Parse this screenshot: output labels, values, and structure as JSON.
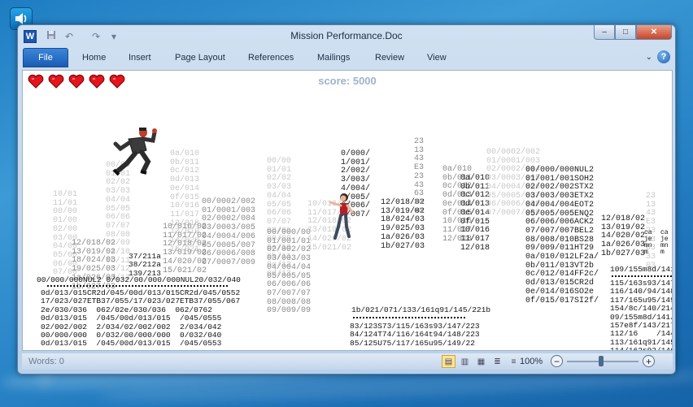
{
  "desktop": {
    "sound_icon": "speaker-icon"
  },
  "window": {
    "title": "Mission Performance.Doc",
    "app_icon_letter": "W",
    "quick_access_icons": [
      "save-icon",
      "undo-icon",
      "redo-icon",
      "customize-icon"
    ],
    "buttons": {
      "minimize": "–",
      "maximize": "□",
      "close": "✕"
    }
  },
  "ribbon": {
    "file_label": "File",
    "tabs": [
      "Home",
      "Insert",
      "Page Layout",
      "References",
      "Mailings",
      "Review",
      "View"
    ],
    "help_label": "?"
  },
  "game": {
    "lives": 5,
    "score_text": "score: 5000",
    "heart_color": "#e8141b"
  },
  "matrix": {
    "c1": "10/01\n11/01\n00/00\n01/00\n02/00\n03/00\n04/00\n05/00\n06/00\n07/00",
    "c2": "00/000/00\n01/001/01\n02/002/02\n03/003/03\n04/004/04\n05/005/05\n06/006/06\n07/007/07\n08/008/08\n09/009/09",
    "c3": "0a/010\n0b/011\n0c/012\n0d/013\n0e/014\n0f/015\n10/016\n11/017\n12/018\n13/019\n14/020\n15/021",
    "c4": "00/00\n01/01\n02/02\n03/03\n04/04\n05/05\n06/06\n07/07\n08/08\n09/09\n0a/10\n0b/11\n0c/12\n0d/13",
    "c5": "00/0002/002\n01/0001/003\n02/0002/004\n03/0003/005\n04/0004/006\n05/0005/007\n06/0006/008\n07/0007/009",
    "c6": "23\n13\n43\nE3\n23\n43\n63\n33\n03",
    "c7": "00/000/000NUL2\n01/001/001SOH2\n02/002/002STX2\n03/003/003ETX2\n04/004/004EOT2\n05/005/005ENQ2\n06/006/006ACK2\n07/007/007BEL2\n08/008/010BS28\n09/009/011HT29\n0a/010/012LF2a/\n0b/011/013VT2b\n0c/012/014FF2c/\n0d/013/015CR2d\n0e/014/016SO2e\n0f/015/017SI2f/",
    "c8": "12/018/02\n13/019/02\n14/020/02\n1a/026/03\n1b/027/03",
    "c9": "0a/010\n0b/011\n0c/012\n0d/013\n0e/014\n0f/015\n10/016\n11/017\n12/018",
    "c10": "00/000/000NUL2\n01/001/001SOH2\n02/002/002STX2",
    "c11": "0/000/\n1/001/\n2/002/\n3/003/\n4/004/\n5/005/\n6/006/\n7/007/",
    "c12": "12/018/02\n13/019/02\n18/024/03\n19/025/03\n1a/026/03\n1b/027/03",
    "c13": "10/016/02\n11/017/02\n12/018/02\n13/019/02\n14/020/02\n15/021/02",
    "b1": "37/211a\n38/212a\n139/213",
    "b2": "00/000/000NUL2 0/032/00/000/000NUL20/032/040",
    "b3": "0d/013/015CR2d/045/00d/013/015CR2d/045/0552\n17/023/027ETB37/055/17/023/027ETB37/055/067\n2e/030/036  062/02e/030/036  062/0762\n0d/013/015  /045/00d/013/015  /045/0555\n02/002/002  2/034/02/002/002  2/034/042\n00/000/000  0/032/00/000/000  0/032/040\n0d/013/015  /045/00d/013/015  /045/0553",
    "b4": "1b/021/071/133/161q91/145/221b",
    "b5": "83/123S73/115/163s93/147/223\n84/124T74/116/164t94/148/223\n85/125U75/117/165u95/149/22",
    "b6": "115/163s93/147/2\n116/140/94/148/2\n117/165u95/149/2\n154/8c/140/214a\n09/155m8d/141/\n157e8f/143/217a\n112/16    /144/\n113/161q91/145/\n114/162r92/146/",
    "b7": "115/163s93/147/223\n116/164t94/148/223\n117/165u95/149/22",
    "b8": "ca\nje\nmn\nm",
    "b9": "109/155m8d/141/2"
  },
  "status": {
    "words": "Words: 0",
    "zoom": "100%",
    "zoom_minus": "−",
    "zoom_plus": "+"
  }
}
